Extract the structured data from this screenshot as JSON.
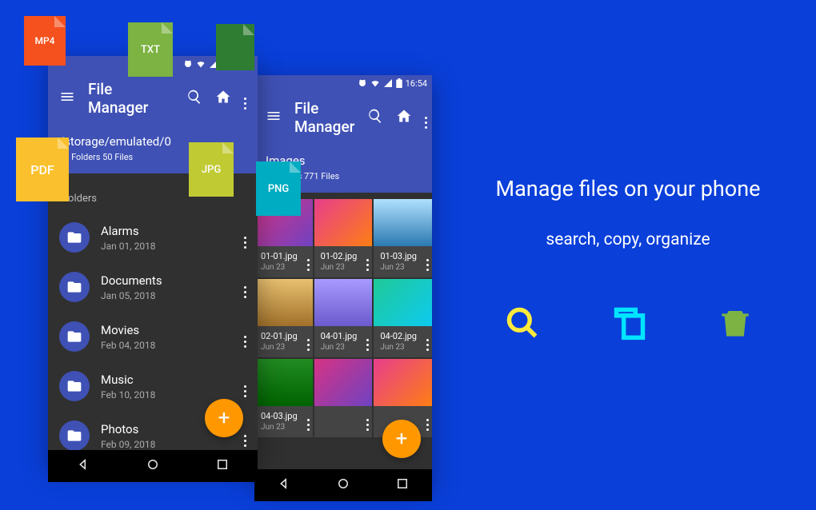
{
  "status": {
    "time": "16:54"
  },
  "app_title": "File Manager",
  "phone1": {
    "path": "/storage/emulated/0",
    "counts": "22 Folders 50 Files",
    "section": "Folders",
    "folders": [
      {
        "name": "Alarms",
        "date": "Jan 01, 2018"
      },
      {
        "name": "Documents",
        "date": "Jan 05, 2018"
      },
      {
        "name": "Movies",
        "date": "Feb 04, 2018"
      },
      {
        "name": "Music",
        "date": "Feb 10, 2018"
      },
      {
        "name": "Photos",
        "date": "Feb 09, 2018"
      }
    ]
  },
  "phone2": {
    "path": "Images",
    "counts": "0 Folders 771 Files",
    "tiles": [
      {
        "name": "01-01.jpg",
        "date": "Jun 23"
      },
      {
        "name": "01-02.jpg",
        "date": "Jun 23"
      },
      {
        "name": "01-03.jpg",
        "date": "Jun 23"
      },
      {
        "name": "02-01.jpg",
        "date": "Jun 23"
      },
      {
        "name": "04-01.jpg",
        "date": "Jun 23"
      },
      {
        "name": "04-02.jpg",
        "date": "Jun 23"
      },
      {
        "name": "04-03.jpg",
        "date": "Jun 23"
      }
    ]
  },
  "badges": {
    "mp4": "MP4",
    "txt": "TXT",
    "pdf": "PDF",
    "jpg": "JPG",
    "png": "PNG"
  },
  "marketing": {
    "headline": "Manage files on your phone",
    "sub": "search, copy, organize"
  },
  "fab": "+",
  "thumb_colors": [
    "linear-gradient(135deg,#d63384,#6f42c1)",
    "linear-gradient(135deg,#e83e8c,#fd7e14)",
    "linear-gradient(180deg,#b0e0ff,#2a7ab0)",
    "linear-gradient(180deg,#e8c070,#a0702a)",
    "linear-gradient(180deg,#a89aff,#6a5acd)",
    "linear-gradient(135deg,#20c997,#0dcaf0)",
    "linear-gradient(180deg,#228b22,#006400)"
  ]
}
